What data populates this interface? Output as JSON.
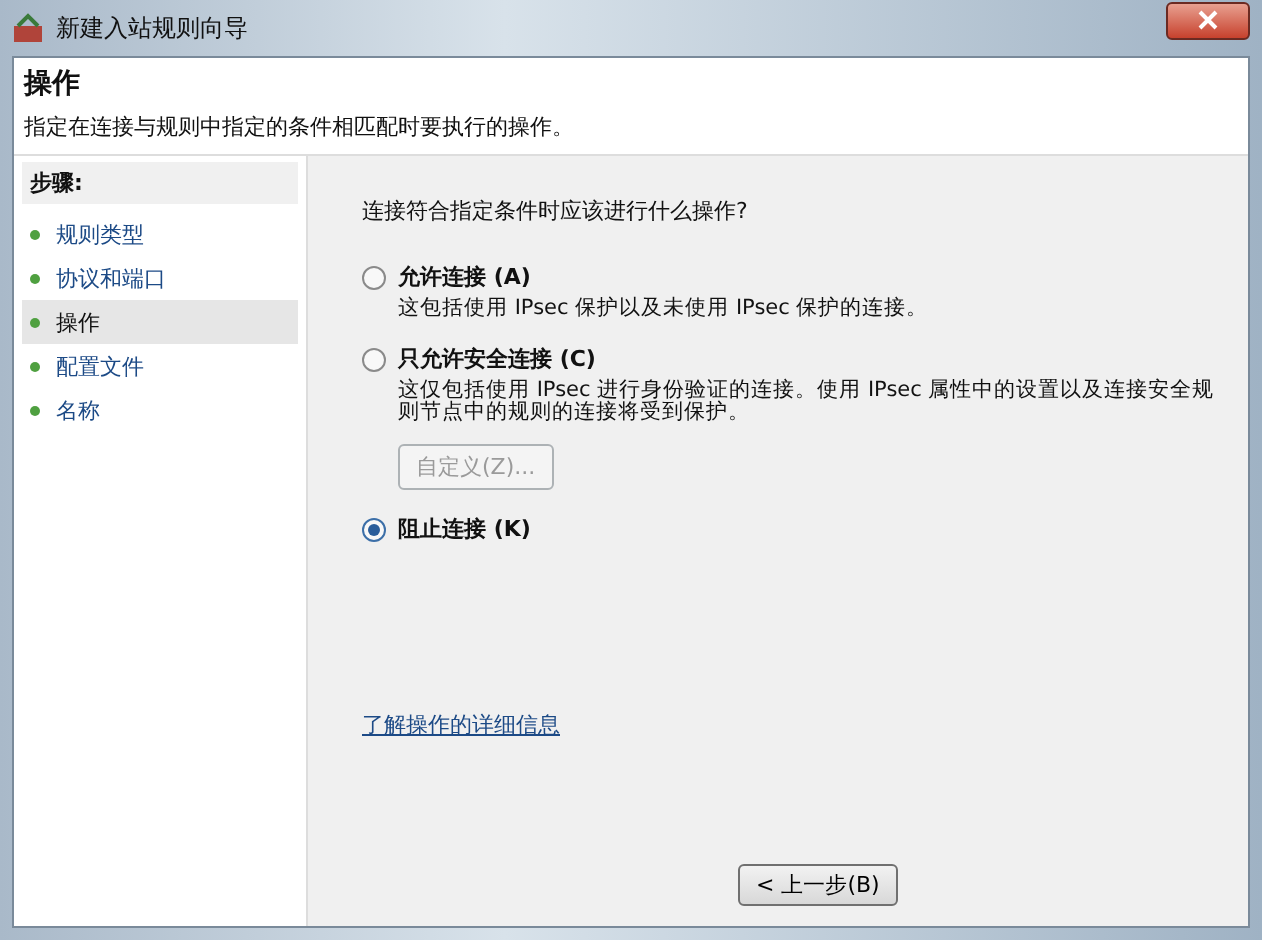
{
  "window": {
    "title": "新建入站规则向导"
  },
  "header": {
    "title": "操作",
    "description": "指定在连接与规则中指定的条件相匹配时要执行的操作。"
  },
  "sidebar": {
    "title": "步骤:",
    "items": [
      {
        "label": "规则类型",
        "selected": false
      },
      {
        "label": "协议和端口",
        "selected": false
      },
      {
        "label": "操作",
        "selected": true
      },
      {
        "label": "配置文件",
        "selected": false
      },
      {
        "label": "名称",
        "selected": false
      }
    ]
  },
  "content": {
    "question": "连接符合指定条件时应该进行什么操作?",
    "options": [
      {
        "label": "允许连接 (A)",
        "description": "这包括使用 IPsec 保护以及未使用 IPsec 保护的连接。",
        "selected": false
      },
      {
        "label": "只允许安全连接 (C)",
        "description": "这仅包括使用 IPsec 进行身份验证的连接。使用 IPsec 属性中的设置以及连接安全规则节点中的规则的连接将受到保护。",
        "selected": false,
        "button": {
          "label": "自定义(Z)...",
          "disabled": true
        }
      },
      {
        "label": "阻止连接 (K)",
        "selected": true
      }
    ],
    "link": "了解操作的详细信息"
  },
  "buttons": {
    "back": "< 上一步(B)"
  }
}
